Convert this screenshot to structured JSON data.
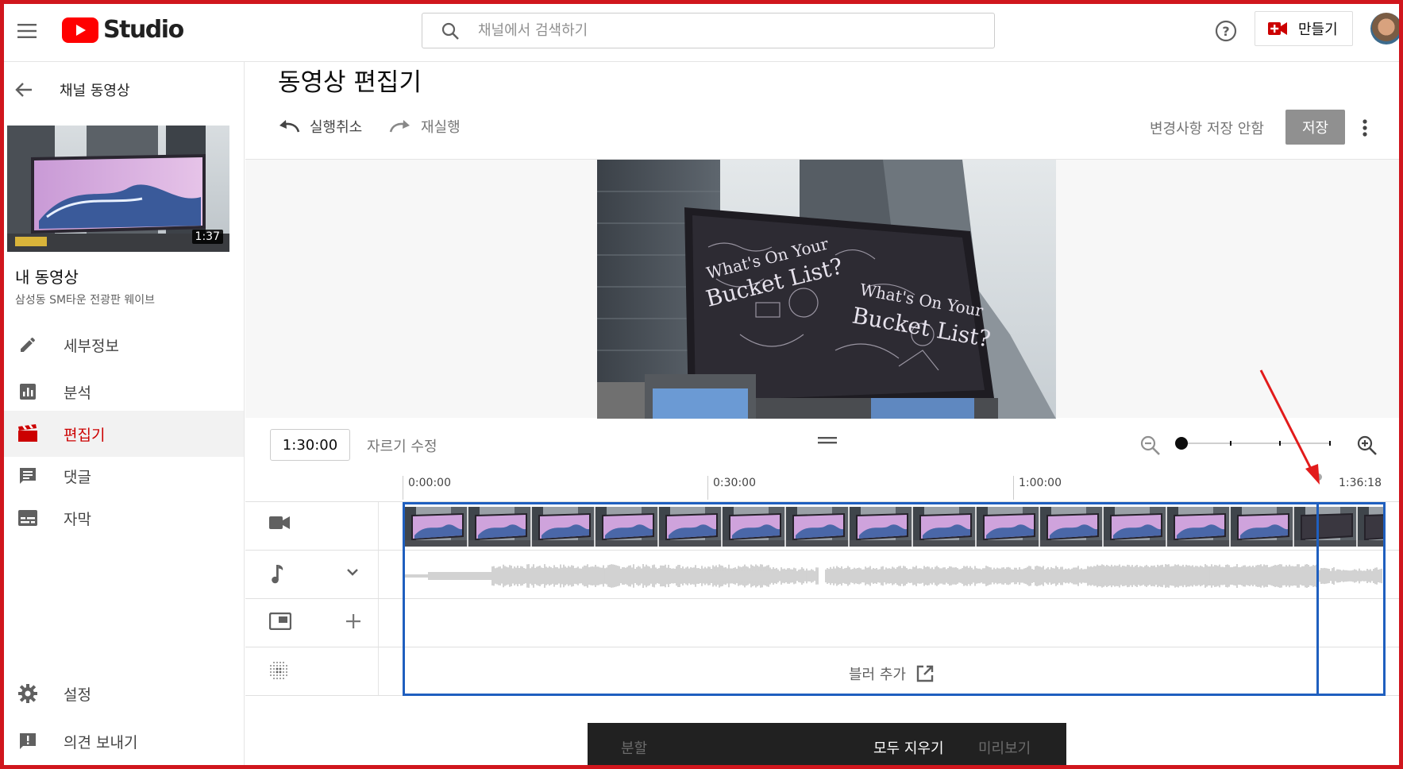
{
  "header": {
    "logo_text": "Studio",
    "search_placeholder": "채널에서 검색하기",
    "create_label": "만들기"
  },
  "sidebar": {
    "back_label": "채널 동영상",
    "thumbnail_duration": "1:37",
    "section_title": "내 동영상",
    "video_title": "삼성동 SM타운 전광판 웨이브",
    "items": [
      {
        "label": "세부정보",
        "icon": "pencil-icon",
        "active": false
      },
      {
        "label": "분석",
        "icon": "analytics-icon",
        "active": false
      },
      {
        "label": "편집기",
        "icon": "clapperboard-icon",
        "active": true
      },
      {
        "label": "댓글",
        "icon": "comment-icon",
        "active": false
      },
      {
        "label": "자막",
        "icon": "subtitles-icon",
        "active": false
      }
    ],
    "bottom_items": [
      {
        "label": "설정",
        "icon": "gear-icon"
      },
      {
        "label": "의견 보내기",
        "icon": "feedback-icon"
      }
    ]
  },
  "editor": {
    "title": "동영상 편집기",
    "undo_label": "실행취소",
    "redo_label": "재실행",
    "discard_label": "변경사항 저장 안함",
    "save_label": "저장",
    "timecode": "1:30:00",
    "trim_label": "자르기 수정",
    "zoom_level": 0
  },
  "timeline": {
    "markers": [
      "0:00:00",
      "0:30:00",
      "1:00:00",
      "1:36:18"
    ],
    "tracks": [
      {
        "name": "video",
        "icon": "video-camera-icon"
      },
      {
        "name": "audio",
        "icon": "music-note-icon",
        "action_icon": "chevron-down-icon"
      },
      {
        "name": "end-screen",
        "icon": "end-screen-icon",
        "action_icon": "plus-icon"
      },
      {
        "name": "blur",
        "icon": "blur-icon"
      }
    ],
    "blur_label": "블러 추가"
  },
  "bottom_bar": {
    "split_label": "분할",
    "clear_all_label": "모두 지우기",
    "preview_label": "미리보기"
  },
  "colors": {
    "brand_red": "#ff0000",
    "active_red": "#cc0000",
    "annotation_red": "#d0161d",
    "selection_blue": "#1f5fbf"
  }
}
